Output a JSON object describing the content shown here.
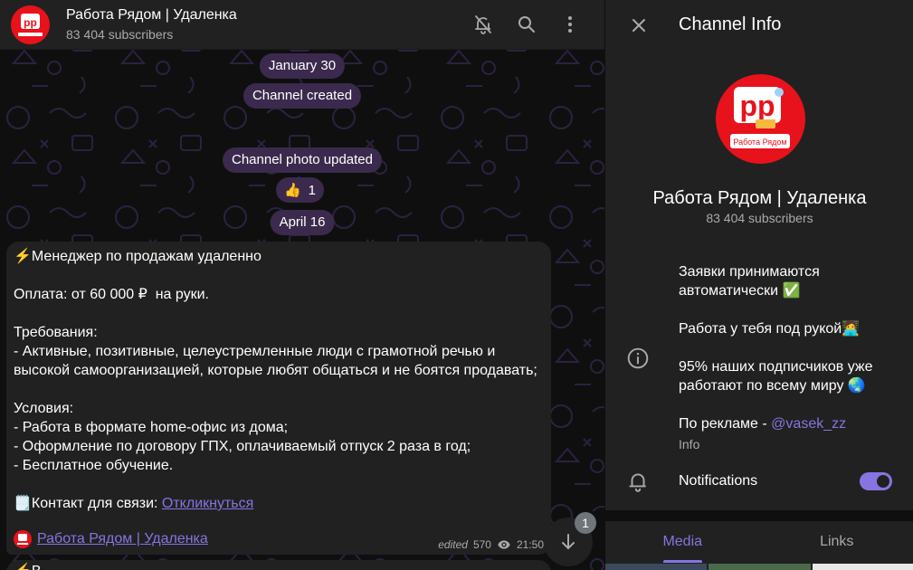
{
  "chat": {
    "title": "Работа Рядом | Удаленка",
    "subscribers": "83 404 subscribers",
    "date_1": "January 30",
    "service_1": "Channel created",
    "service_2": "Channel photo updated",
    "reaction": {
      "emoji": "👍",
      "count": "1"
    },
    "date_2": "April 16",
    "message": {
      "line1": "⚡Менеджер по продажам удаленно",
      "body": "Оплата: от 60 000 ₽  на руки.\n\nТребования:\n- Активные, позитивные, целеустремленные люди с грамотной речью и высокой самоорганизацией, которые любят общаться и не боятся продавать;\n\nУсловия:\n- Работа в формате home-офис из дома;\n- Оформление по договору ГПХ, оплачиваемый отпуск 2 раза в год;\n- Бесплатное обучение.",
      "contact_prefix": "🗒️Контакт для связи: ",
      "contact_link": "Откликнуться",
      "signature_link": "Работа Рядом | Удаленка",
      "edited": "edited",
      "views": "570",
      "time": "21:50"
    },
    "next_message_start": "⚡В",
    "unread_badge": "1"
  },
  "panel": {
    "title": "Channel Info",
    "name": "Работа Рядом | Удаленка",
    "subscribers": "83 404 subscribers",
    "description": "Заявки принимаются автоматически ✅\n\nРабота у тебя под рукой🧑‍💻\n\n95% наших подписчиков уже работают по всему миру 🌏\n\nПо рекламе - ",
    "ad_contact": "@vasek_zz",
    "description_label": "Info",
    "notifications_label": "Notifications",
    "notifications_on": true,
    "tabs": [
      "Media",
      "Links"
    ]
  },
  "logo_text": "Работа Рядом",
  "colors": {
    "accent": "#8774e1",
    "brand_red": "#e8121c",
    "service_pill": "#3b2a4d"
  }
}
